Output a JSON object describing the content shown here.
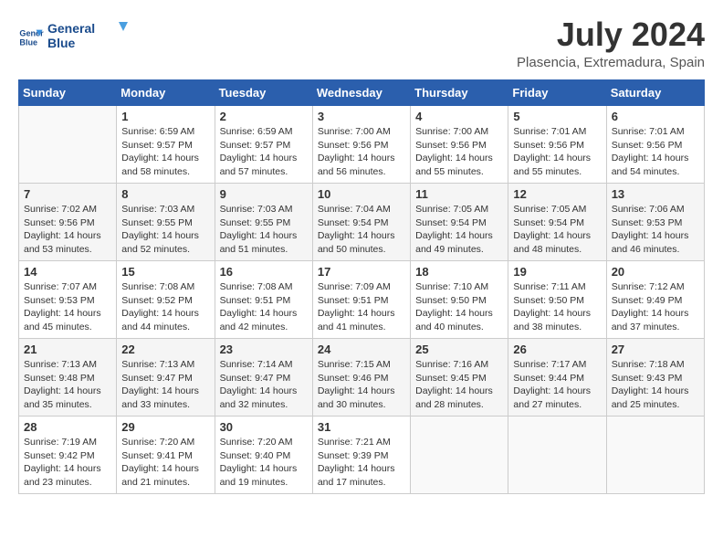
{
  "logo": {
    "line1": "General",
    "line2": "Blue"
  },
  "title": "July 2024",
  "subtitle": "Plasencia, Extremadura, Spain",
  "days_header": [
    "Sunday",
    "Monday",
    "Tuesday",
    "Wednesday",
    "Thursday",
    "Friday",
    "Saturday"
  ],
  "weeks": [
    [
      {
        "day": "",
        "info": ""
      },
      {
        "day": "1",
        "info": "Sunrise: 6:59 AM\nSunset: 9:57 PM\nDaylight: 14 hours\nand 58 minutes."
      },
      {
        "day": "2",
        "info": "Sunrise: 6:59 AM\nSunset: 9:57 PM\nDaylight: 14 hours\nand 57 minutes."
      },
      {
        "day": "3",
        "info": "Sunrise: 7:00 AM\nSunset: 9:56 PM\nDaylight: 14 hours\nand 56 minutes."
      },
      {
        "day": "4",
        "info": "Sunrise: 7:00 AM\nSunset: 9:56 PM\nDaylight: 14 hours\nand 55 minutes."
      },
      {
        "day": "5",
        "info": "Sunrise: 7:01 AM\nSunset: 9:56 PM\nDaylight: 14 hours\nand 55 minutes."
      },
      {
        "day": "6",
        "info": "Sunrise: 7:01 AM\nSunset: 9:56 PM\nDaylight: 14 hours\nand 54 minutes."
      }
    ],
    [
      {
        "day": "7",
        "info": "Sunrise: 7:02 AM\nSunset: 9:56 PM\nDaylight: 14 hours\nand 53 minutes."
      },
      {
        "day": "8",
        "info": "Sunrise: 7:03 AM\nSunset: 9:55 PM\nDaylight: 14 hours\nand 52 minutes."
      },
      {
        "day": "9",
        "info": "Sunrise: 7:03 AM\nSunset: 9:55 PM\nDaylight: 14 hours\nand 51 minutes."
      },
      {
        "day": "10",
        "info": "Sunrise: 7:04 AM\nSunset: 9:54 PM\nDaylight: 14 hours\nand 50 minutes."
      },
      {
        "day": "11",
        "info": "Sunrise: 7:05 AM\nSunset: 9:54 PM\nDaylight: 14 hours\nand 49 minutes."
      },
      {
        "day": "12",
        "info": "Sunrise: 7:05 AM\nSunset: 9:54 PM\nDaylight: 14 hours\nand 48 minutes."
      },
      {
        "day": "13",
        "info": "Sunrise: 7:06 AM\nSunset: 9:53 PM\nDaylight: 14 hours\nand 46 minutes."
      }
    ],
    [
      {
        "day": "14",
        "info": "Sunrise: 7:07 AM\nSunset: 9:53 PM\nDaylight: 14 hours\nand 45 minutes."
      },
      {
        "day": "15",
        "info": "Sunrise: 7:08 AM\nSunset: 9:52 PM\nDaylight: 14 hours\nand 44 minutes."
      },
      {
        "day": "16",
        "info": "Sunrise: 7:08 AM\nSunset: 9:51 PM\nDaylight: 14 hours\nand 42 minutes."
      },
      {
        "day": "17",
        "info": "Sunrise: 7:09 AM\nSunset: 9:51 PM\nDaylight: 14 hours\nand 41 minutes."
      },
      {
        "day": "18",
        "info": "Sunrise: 7:10 AM\nSunset: 9:50 PM\nDaylight: 14 hours\nand 40 minutes."
      },
      {
        "day": "19",
        "info": "Sunrise: 7:11 AM\nSunset: 9:50 PM\nDaylight: 14 hours\nand 38 minutes."
      },
      {
        "day": "20",
        "info": "Sunrise: 7:12 AM\nSunset: 9:49 PM\nDaylight: 14 hours\nand 37 minutes."
      }
    ],
    [
      {
        "day": "21",
        "info": "Sunrise: 7:13 AM\nSunset: 9:48 PM\nDaylight: 14 hours\nand 35 minutes."
      },
      {
        "day": "22",
        "info": "Sunrise: 7:13 AM\nSunset: 9:47 PM\nDaylight: 14 hours\nand 33 minutes."
      },
      {
        "day": "23",
        "info": "Sunrise: 7:14 AM\nSunset: 9:47 PM\nDaylight: 14 hours\nand 32 minutes."
      },
      {
        "day": "24",
        "info": "Sunrise: 7:15 AM\nSunset: 9:46 PM\nDaylight: 14 hours\nand 30 minutes."
      },
      {
        "day": "25",
        "info": "Sunrise: 7:16 AM\nSunset: 9:45 PM\nDaylight: 14 hours\nand 28 minutes."
      },
      {
        "day": "26",
        "info": "Sunrise: 7:17 AM\nSunset: 9:44 PM\nDaylight: 14 hours\nand 27 minutes."
      },
      {
        "day": "27",
        "info": "Sunrise: 7:18 AM\nSunset: 9:43 PM\nDaylight: 14 hours\nand 25 minutes."
      }
    ],
    [
      {
        "day": "28",
        "info": "Sunrise: 7:19 AM\nSunset: 9:42 PM\nDaylight: 14 hours\nand 23 minutes."
      },
      {
        "day": "29",
        "info": "Sunrise: 7:20 AM\nSunset: 9:41 PM\nDaylight: 14 hours\nand 21 minutes."
      },
      {
        "day": "30",
        "info": "Sunrise: 7:20 AM\nSunset: 9:40 PM\nDaylight: 14 hours\nand 19 minutes."
      },
      {
        "day": "31",
        "info": "Sunrise: 7:21 AM\nSunset: 9:39 PM\nDaylight: 14 hours\nand 17 minutes."
      },
      {
        "day": "",
        "info": ""
      },
      {
        "day": "",
        "info": ""
      },
      {
        "day": "",
        "info": ""
      }
    ]
  ]
}
